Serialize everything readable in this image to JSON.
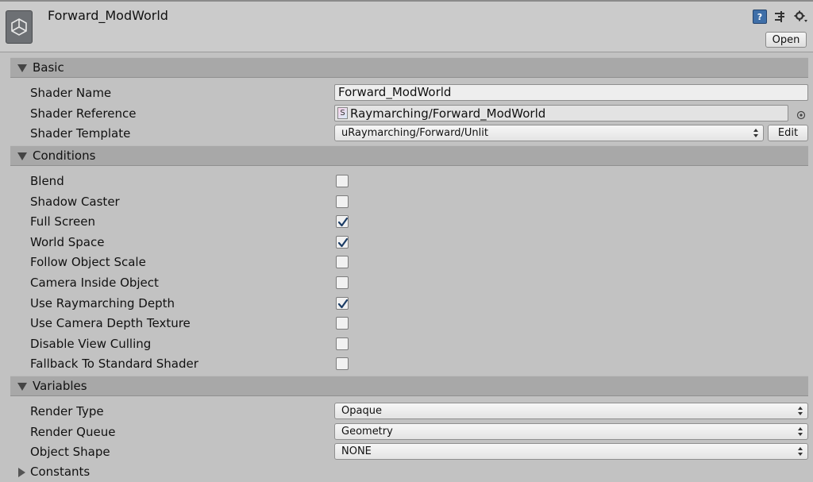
{
  "header": {
    "title": "Forward_ModWorld",
    "open_label": "Open",
    "help_icon": "help-icon",
    "preset_icon": "preset-icon",
    "gear_icon": "gear-icon"
  },
  "basic": {
    "section_label": "Basic",
    "shader_name_label": "Shader Name",
    "shader_name_value": "Forward_ModWorld",
    "shader_reference_label": "Shader Reference",
    "shader_reference_value": "Raymarching/Forward_ModWorld",
    "shader_template_label": "Shader Template",
    "shader_template_value": "uRaymarching/Forward/Unlit",
    "edit_label": "Edit"
  },
  "conditions": {
    "section_label": "Conditions",
    "items": [
      {
        "label": "Blend",
        "checked": false
      },
      {
        "label": "Shadow Caster",
        "checked": false
      },
      {
        "label": "Full Screen",
        "checked": true
      },
      {
        "label": "World Space",
        "checked": true
      },
      {
        "label": "Follow Object Scale",
        "checked": false
      },
      {
        "label": "Camera Inside Object",
        "checked": false
      },
      {
        "label": "Use Raymarching Depth",
        "checked": true
      },
      {
        "label": "Use Camera Depth Texture",
        "checked": false
      },
      {
        "label": "Disable View Culling",
        "checked": false
      },
      {
        "label": "Fallback To Standard Shader",
        "checked": false
      }
    ]
  },
  "variables": {
    "section_label": "Variables",
    "render_type_label": "Render Type",
    "render_type_value": "Opaque",
    "render_queue_label": "Render Queue",
    "render_queue_value": "Geometry",
    "object_shape_label": "Object Shape",
    "object_shape_value": "NONE"
  },
  "constants": {
    "label": "Constants"
  },
  "colors": {
    "background": "#c2c2c2",
    "section_header": "#a8a8a8",
    "checkmark": "#1c3d66"
  }
}
